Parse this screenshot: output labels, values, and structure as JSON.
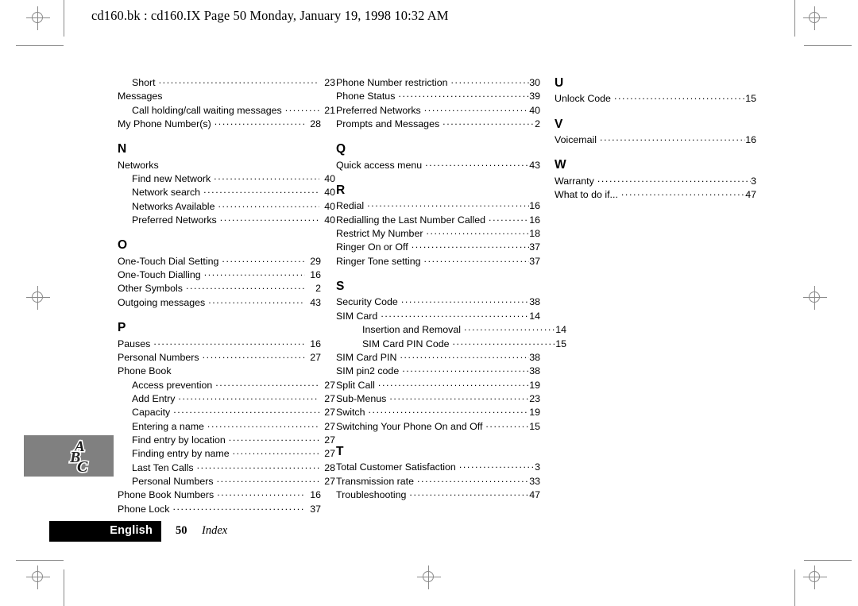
{
  "header": {
    "text": "cd160.bk : cd160.IX  Page 50  Monday, January 19, 1998  10:32 AM"
  },
  "footer": {
    "language_label": "English",
    "page_number": "50",
    "section_label": "Index"
  },
  "tab_graphic": {
    "logo_letters": [
      "A",
      "B",
      "C"
    ],
    "background_color": "#808080"
  },
  "index": {
    "columns": [
      {
        "id": "column-1",
        "blocks": [
          {
            "letter": null,
            "entries": [
              {
                "label": "Short",
                "page": "23",
                "level": 2,
                "dots": true
              },
              {
                "label": "Messages",
                "page": "",
                "level": 1,
                "dots": false
              },
              {
                "label": "Call holding/call waiting messages",
                "page": "21",
                "level": 2,
                "dots": true
              },
              {
                "label": "My Phone Number(s)",
                "page": "28",
                "level": 1,
                "dots": true
              }
            ]
          },
          {
            "letter": "N",
            "entries": [
              {
                "label": "Networks",
                "page": "",
                "level": 1,
                "dots": false
              },
              {
                "label": "Find new Network",
                "page": "40",
                "level": 2,
                "dots": true
              },
              {
                "label": "Network search",
                "page": "40",
                "level": 2,
                "dots": true
              },
              {
                "label": "Networks Available",
                "page": "40",
                "level": 2,
                "dots": true
              },
              {
                "label": "Preferred Networks",
                "page": "40",
                "level": 2,
                "dots": true
              }
            ]
          },
          {
            "letter": "O",
            "entries": [
              {
                "label": "One-Touch Dial Setting",
                "page": "29",
                "level": 1,
                "dots": true
              },
              {
                "label": "One-Touch Dialling",
                "page": "16",
                "level": 1,
                "dots": true
              },
              {
                "label": "Other Symbols",
                "page": "2",
                "level": 1,
                "dots": true
              },
              {
                "label": "Outgoing messages",
                "page": "43",
                "level": 1,
                "dots": true
              }
            ]
          },
          {
            "letter": "P",
            "entries": [
              {
                "label": "Pauses",
                "page": "16",
                "level": 1,
                "dots": true
              },
              {
                "label": "Personal Numbers",
                "page": "27",
                "level": 1,
                "dots": true
              },
              {
                "label": "Phone Book",
                "page": "",
                "level": 1,
                "dots": false
              },
              {
                "label": "Access prevention",
                "page": "27",
                "level": 2,
                "dots": true
              },
              {
                "label": "Add Entry",
                "page": "27",
                "level": 2,
                "dots": true
              },
              {
                "label": "Capacity",
                "page": "27",
                "level": 2,
                "dots": true
              },
              {
                "label": "Entering a name",
                "page": "27",
                "level": 2,
                "dots": true
              },
              {
                "label": "Find entry by location",
                "page": "27",
                "level": 2,
                "dots": true
              },
              {
                "label": "Finding entry by name",
                "page": "27",
                "level": 2,
                "dots": true
              },
              {
                "label": "Last Ten Calls",
                "page": "28",
                "level": 2,
                "dots": true
              },
              {
                "label": "Personal Numbers",
                "page": "27",
                "level": 2,
                "dots": true
              },
              {
                "label": "Phone Book Numbers",
                "page": "16",
                "level": 1,
                "dots": true
              },
              {
                "label": "Phone Lock",
                "page": "37",
                "level": 1,
                "dots": true
              }
            ]
          }
        ]
      },
      {
        "id": "column-2",
        "blocks": [
          {
            "letter": null,
            "entries": [
              {
                "label": "Phone Number restriction",
                "page": "30",
                "level": 1,
                "dots": true
              },
              {
                "label": "Phone Status",
                "page": "39",
                "level": 1,
                "dots": true
              },
              {
                "label": "Preferred Networks",
                "page": "40",
                "level": 1,
                "dots": true
              },
              {
                "label": "Prompts and Messages",
                "page": "2",
                "level": 1,
                "dots": true
              }
            ]
          },
          {
            "letter": "Q",
            "entries": [
              {
                "label": "Quick access menu",
                "page": "43",
                "level": 1,
                "dots": true
              }
            ]
          },
          {
            "letter": "R",
            "entries": [
              {
                "label": "Redial",
                "page": "16",
                "level": 1,
                "dots": true
              },
              {
                "label": "Redialling the Last Number Called",
                "page": "16",
                "level": 1,
                "dots": true
              },
              {
                "label": "Restrict My Number",
                "page": "18",
                "level": 1,
                "dots": true
              },
              {
                "label": "Ringer On or Off",
                "page": "37",
                "level": 1,
                "dots": true
              },
              {
                "label": "Ringer Tone setting",
                "page": "37",
                "level": 1,
                "dots": true
              }
            ]
          },
          {
            "letter": "S",
            "entries": [
              {
                "label": "Security Code",
                "page": "38",
                "level": 1,
                "dots": true
              },
              {
                "label": "SIM Card",
                "page": "14",
                "level": 1,
                "dots": true
              },
              {
                "label": "Insertion and Removal",
                "page": "14",
                "level": 3,
                "dots": true
              },
              {
                "label": "SIM Card PIN Code",
                "page": "15",
                "level": 3,
                "dots": true
              },
              {
                "label": "SIM Card PIN",
                "page": "38",
                "level": 1,
                "dots": true
              },
              {
                "label": "SIM pin2 code",
                "page": "38",
                "level": 1,
                "dots": true
              },
              {
                "label": "Split Call",
                "page": "19",
                "level": 1,
                "dots": true
              },
              {
                "label": "Sub-Menus",
                "page": "23",
                "level": 1,
                "dots": true
              },
              {
                "label": "Switch",
                "page": "19",
                "level": 1,
                "dots": true
              },
              {
                "label": "Switching Your Phone On and Off",
                "page": "15",
                "level": 1,
                "dots": true
              }
            ]
          },
          {
            "letter": "T",
            "entries": [
              {
                "label": "Total Customer Satisfaction",
                "page": "3",
                "level": 1,
                "dots": true
              },
              {
                "label": "Transmission rate",
                "page": "33",
                "level": 1,
                "dots": true
              },
              {
                "label": "Troubleshooting",
                "page": "47",
                "level": 1,
                "dots": true
              }
            ]
          }
        ]
      },
      {
        "id": "column-3",
        "blocks": [
          {
            "letter": "U",
            "entries": [
              {
                "label": "Unlock Code",
                "page": "15",
                "level": 1,
                "dots": true
              }
            ]
          },
          {
            "letter": "V",
            "entries": [
              {
                "label": "Voicemail",
                "page": "16",
                "level": 1,
                "dots": true
              }
            ]
          },
          {
            "letter": "W",
            "entries": [
              {
                "label": "Warranty",
                "page": "3",
                "level": 1,
                "dots": true
              },
              {
                "label": "What to do if...",
                "page": "47",
                "level": 1,
                "dots": true
              }
            ]
          }
        ]
      }
    ]
  }
}
